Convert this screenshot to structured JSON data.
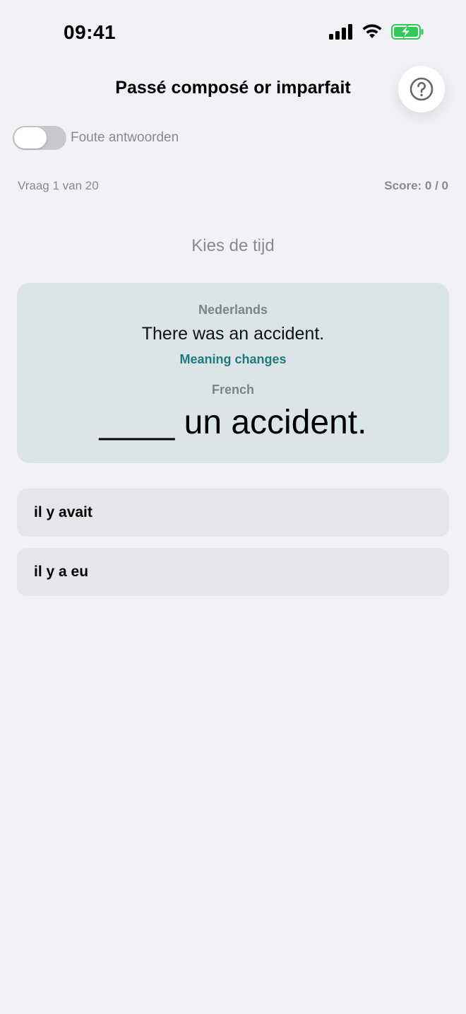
{
  "status_bar": {
    "time": "09:41",
    "icons": [
      "signal-icon",
      "wifi-icon",
      "battery-charging-icon"
    ],
    "battery_color": "#34c759"
  },
  "header": {
    "title": "Passé composé or imparfait",
    "help_icon": "question-circle-icon"
  },
  "toggle": {
    "label": "Foute antwoorden",
    "on": false
  },
  "progress": {
    "question_counter": "Vraag 1 van 20",
    "score": "Score: 0 / 0"
  },
  "prompt": "Kies de tijd",
  "card": {
    "source_language": "Nederlands",
    "source_sentence": "There was an accident.",
    "meaning_note": "Meaning changes",
    "target_language": "French",
    "target_sentence": "____ un accident.",
    "accent_color": "#1f7a80"
  },
  "options": [
    {
      "label": "il y avait"
    },
    {
      "label": "il y a eu"
    }
  ]
}
